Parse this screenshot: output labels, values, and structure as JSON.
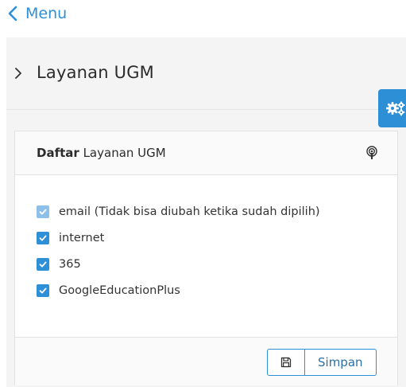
{
  "nav": {
    "back_label": "Menu"
  },
  "header": {
    "title": "Layanan UGM"
  },
  "panel": {
    "title_bold": "Daftar",
    "title_rest": "Layanan UGM",
    "items": [
      {
        "label": "email (Tidak bisa diubah ketika sudah dipilih)",
        "checked": true,
        "disabled": true
      },
      {
        "label": "internet",
        "checked": true,
        "disabled": false
      },
      {
        "label": "365",
        "checked": true,
        "disabled": false
      },
      {
        "label": "GoogleEducationPlus",
        "checked": true,
        "disabled": false
      }
    ]
  },
  "footer": {
    "save_label": "Simpan"
  },
  "colors": {
    "accent": "#2d8fd6",
    "disabled_check": "#8cc0e8"
  },
  "icons": [
    "chevron-left-icon",
    "chevron-right-icon",
    "gear-icon",
    "broadcast-icon",
    "check-icon",
    "floppy-disk-icon"
  ]
}
